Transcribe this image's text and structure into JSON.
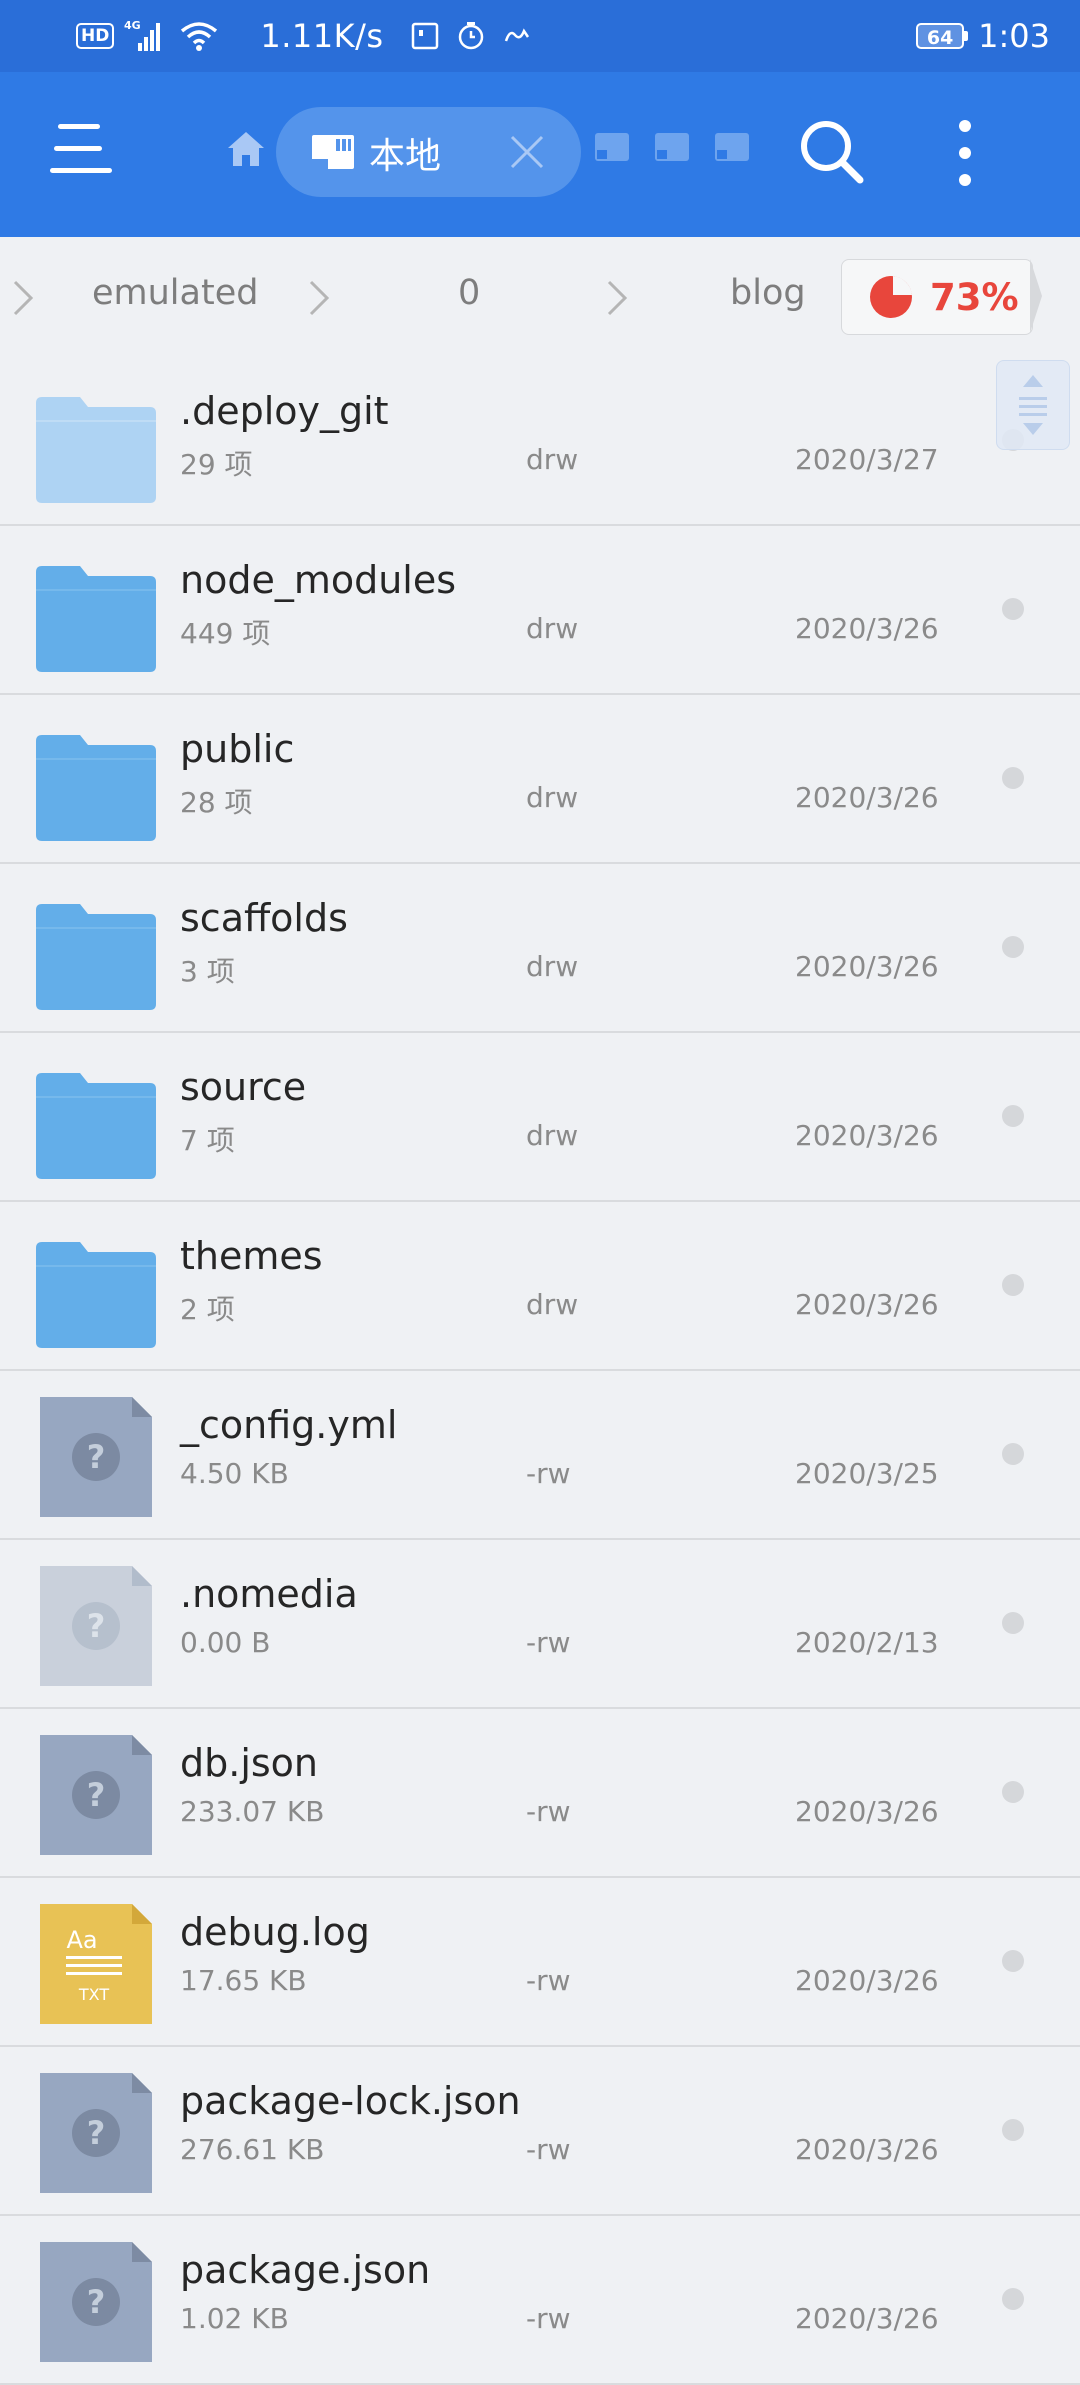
{
  "status_bar": {
    "hd": "HD",
    "network": "4G",
    "speed": "1.11K/s",
    "battery": "64",
    "time": "1:03"
  },
  "toolbar": {
    "tab_label": "本地",
    "accent": "#2f7ae5"
  },
  "breadcrumb": {
    "items": [
      "emulated",
      "0",
      "blog"
    ],
    "storage_percent": "73%",
    "storage_color": "#e8463c"
  },
  "files": [
    {
      "name": ".deploy_git",
      "meta": "29 项",
      "perm": "drw",
      "date": "2020/3/27",
      "icon": "folder-icon",
      "faded": true
    },
    {
      "name": "node_modules",
      "meta": "449 项",
      "perm": "drw",
      "date": "2020/3/26",
      "icon": "folder-icon"
    },
    {
      "name": "public",
      "meta": "28 项",
      "perm": "drw",
      "date": "2020/3/26",
      "icon": "folder-icon"
    },
    {
      "name": "scaffolds",
      "meta": "3 项",
      "perm": "drw",
      "date": "2020/3/26",
      "icon": "folder-icon"
    },
    {
      "name": "source",
      "meta": "7 项",
      "perm": "drw",
      "date": "2020/3/26",
      "icon": "folder-icon"
    },
    {
      "name": "themes",
      "meta": "2 项",
      "perm": "drw",
      "date": "2020/3/26",
      "icon": "folder-icon"
    },
    {
      "name": "_config.yml",
      "meta": "4.50 KB",
      "perm": "-rw",
      "date": "2020/3/25",
      "icon": "unknown-file-icon"
    },
    {
      "name": ".nomedia",
      "meta": "0.00 B",
      "perm": "-rw",
      "date": "2020/2/13",
      "icon": "unknown-file-icon",
      "faded": true
    },
    {
      "name": "db.json",
      "meta": "233.07 KB",
      "perm": "-rw",
      "date": "2020/3/26",
      "icon": "unknown-file-icon"
    },
    {
      "name": "debug.log",
      "meta": "17.65 KB",
      "perm": "-rw",
      "date": "2020/3/26",
      "icon": "text-file-icon"
    },
    {
      "name": "package-lock.json",
      "meta": "276.61 KB",
      "perm": "-rw",
      "date": "2020/3/26",
      "icon": "unknown-file-icon"
    },
    {
      "name": "package.json",
      "meta": "1.02 KB",
      "perm": "-rw",
      "date": "2020/3/26",
      "icon": "unknown-file-icon"
    }
  ],
  "text_icon_label": "Aa",
  "text_icon_ext": "TXT"
}
